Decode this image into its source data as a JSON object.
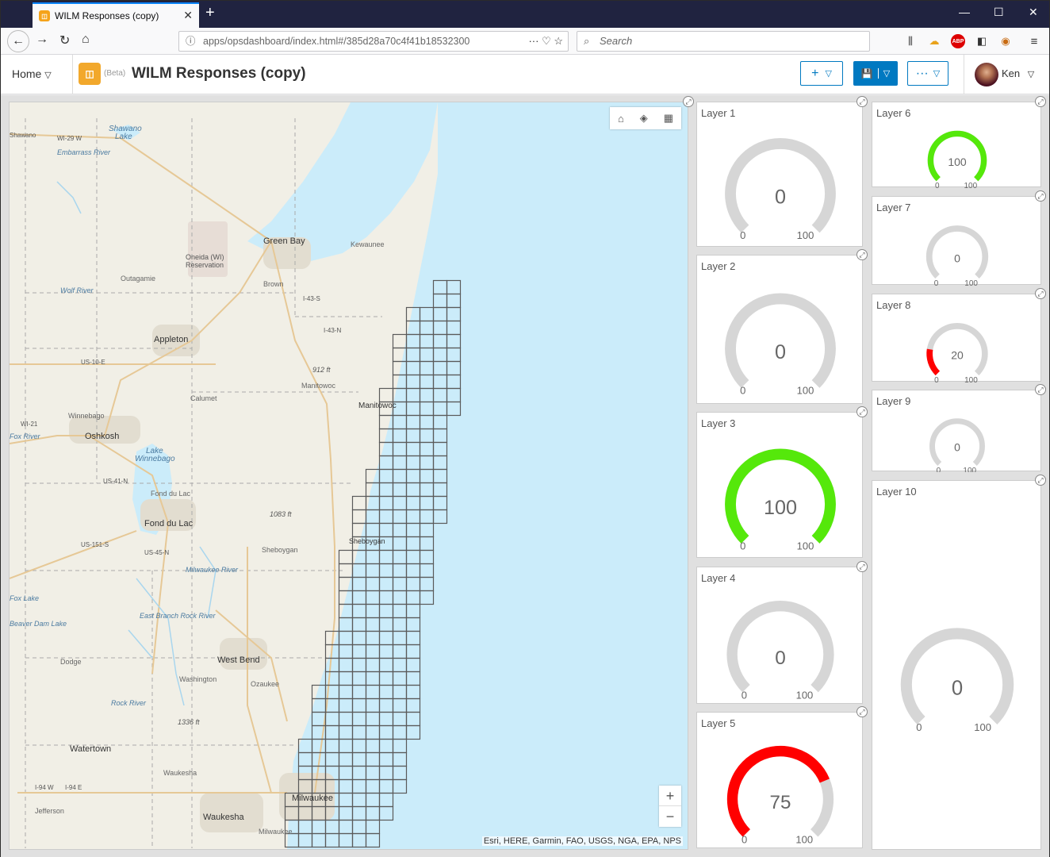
{
  "browser": {
    "tab_title": "WILM Responses (copy)",
    "url": "apps/opsdashboard/index.html#/385d28a70c4f41b18532300",
    "search_placeholder": "Search"
  },
  "header": {
    "home_label": "Home",
    "beta_label": "(Beta)",
    "title": "WILM Responses (copy)",
    "user_name": "Ken",
    "add_icon": "+",
    "save_icon": "💾",
    "more_icon": "···"
  },
  "map": {
    "attribution": "Esri, HERE, Garmin, FAO, USGS, NGA, EPA, NPS",
    "zoom_in": "+",
    "zoom_out": "−",
    "labels": [
      {
        "id": "shawano",
        "text": "Shawano"
      },
      {
        "id": "lake1",
        "text": "Lake"
      },
      {
        "id": "green-bay",
        "text": "Green Bay"
      },
      {
        "id": "kewaunee",
        "text": "Kewaunee"
      },
      {
        "id": "oneida",
        "text": "Oneida (WI)"
      },
      {
        "id": "reservation",
        "text": "Reservation"
      },
      {
        "id": "outagamie",
        "text": "Outagamie"
      },
      {
        "id": "brown",
        "text": "Brown"
      },
      {
        "id": "appleton",
        "text": "Appleton"
      },
      {
        "id": "us10",
        "text": "US-10-E"
      },
      {
        "id": "912ft",
        "text": "912 ft"
      },
      {
        "id": "manitowoc-co",
        "text": "Manitowoc"
      },
      {
        "id": "calumet",
        "text": "Calumet"
      },
      {
        "id": "manitowoc",
        "text": "Manitowoc"
      },
      {
        "id": "winnebago",
        "text": "Winnebago"
      },
      {
        "id": "oshkosh",
        "text": "Oshkosh"
      },
      {
        "id": "lake-winnebago",
        "text": "Lake"
      },
      {
        "id": "lake-winnebago2",
        "text": "Winnebago"
      },
      {
        "id": "fond-du-lac-co",
        "text": "Fond du Lac"
      },
      {
        "id": "fond-du-lac",
        "text": "Fond du Lac"
      },
      {
        "id": "1083ft",
        "text": "1083 ft"
      },
      {
        "id": "sheboygan-co",
        "text": "Sheboygan"
      },
      {
        "id": "sheboygan",
        "text": "Sheboygan"
      },
      {
        "id": "west-bend",
        "text": "West Bend"
      },
      {
        "id": "dodge",
        "text": "Dodge"
      },
      {
        "id": "washington",
        "text": "Washington"
      },
      {
        "id": "ozaukee",
        "text": "Ozaukee"
      },
      {
        "id": "1336ft",
        "text": "1336 ft"
      },
      {
        "id": "watertown",
        "text": "Watertown"
      },
      {
        "id": "waukesha-co",
        "text": "Waukesha"
      },
      {
        "id": "milwaukee",
        "text": "Milwaukee"
      },
      {
        "id": "jefferson",
        "text": "Jefferson"
      },
      {
        "id": "waukesha",
        "text": "Waukesha"
      },
      {
        "id": "milwaukee-co",
        "text": "Milwaukee"
      },
      {
        "id": "i94",
        "text": "I-94 E"
      },
      {
        "id": "i94w",
        "text": "I-94 W"
      },
      {
        "id": "wi29",
        "text": "WI-29 W"
      },
      {
        "id": "shawano-rd",
        "text": "Shawano"
      },
      {
        "id": "wi21",
        "text": "WI-21"
      },
      {
        "id": "wolf-river",
        "text": "Wolf River"
      },
      {
        "id": "fox-river",
        "text": "Fox River"
      },
      {
        "id": "embarrass",
        "text": "Embarrass River"
      },
      {
        "id": "rock-river",
        "text": "Rock River"
      },
      {
        "id": "milwaukee-river",
        "text": "Milwaukee River"
      },
      {
        "id": "east-branch",
        "text": "East Branch Rock River"
      },
      {
        "id": "fox-lake",
        "text": "Fox Lake"
      },
      {
        "id": "beaver-dam",
        "text": "Beaver Dam Lake"
      },
      {
        "id": "us41",
        "text": "US-41-N"
      },
      {
        "id": "us45",
        "text": "US-45-N"
      },
      {
        "id": "i43s",
        "text": "I-43-S"
      },
      {
        "id": "i43n",
        "text": "I-43-N"
      },
      {
        "id": "us151",
        "text": "US-151-S"
      }
    ]
  },
  "gauges": [
    {
      "title": "Layer 1",
      "value": "0",
      "min": "0",
      "max": "100",
      "fraction": 0,
      "color": "#d6d6d6"
    },
    {
      "title": "Layer 2",
      "value": "0",
      "min": "0",
      "max": "100",
      "fraction": 0,
      "color": "#d6d6d6"
    },
    {
      "title": "Layer 3",
      "value": "100",
      "min": "0",
      "max": "100",
      "fraction": 1,
      "color": "#55e80b"
    },
    {
      "title": "Layer 4",
      "value": "0",
      "min": "0",
      "max": "100",
      "fraction": 0,
      "color": "#d6d6d6"
    },
    {
      "title": "Layer 5",
      "value": "75",
      "min": "0",
      "max": "100",
      "fraction": 0.75,
      "color": "#ff0000"
    },
    {
      "title": "Layer 6",
      "value": "100",
      "min": "0",
      "max": "100",
      "fraction": 1,
      "color": "#55e80b"
    },
    {
      "title": "Layer 7",
      "value": "0",
      "min": "0",
      "max": "100",
      "fraction": 0,
      "color": "#d6d6d6"
    },
    {
      "title": "Layer 8",
      "value": "20",
      "min": "0",
      "max": "100",
      "fraction": 0.2,
      "color": "#ff0000"
    },
    {
      "title": "Layer 9",
      "value": "0",
      "min": "0",
      "max": "100",
      "fraction": 0,
      "color": "#d6d6d6"
    },
    {
      "title": "Layer 10",
      "value": "0",
      "min": "0",
      "max": "100",
      "fraction": 0,
      "color": "#d6d6d6"
    }
  ]
}
